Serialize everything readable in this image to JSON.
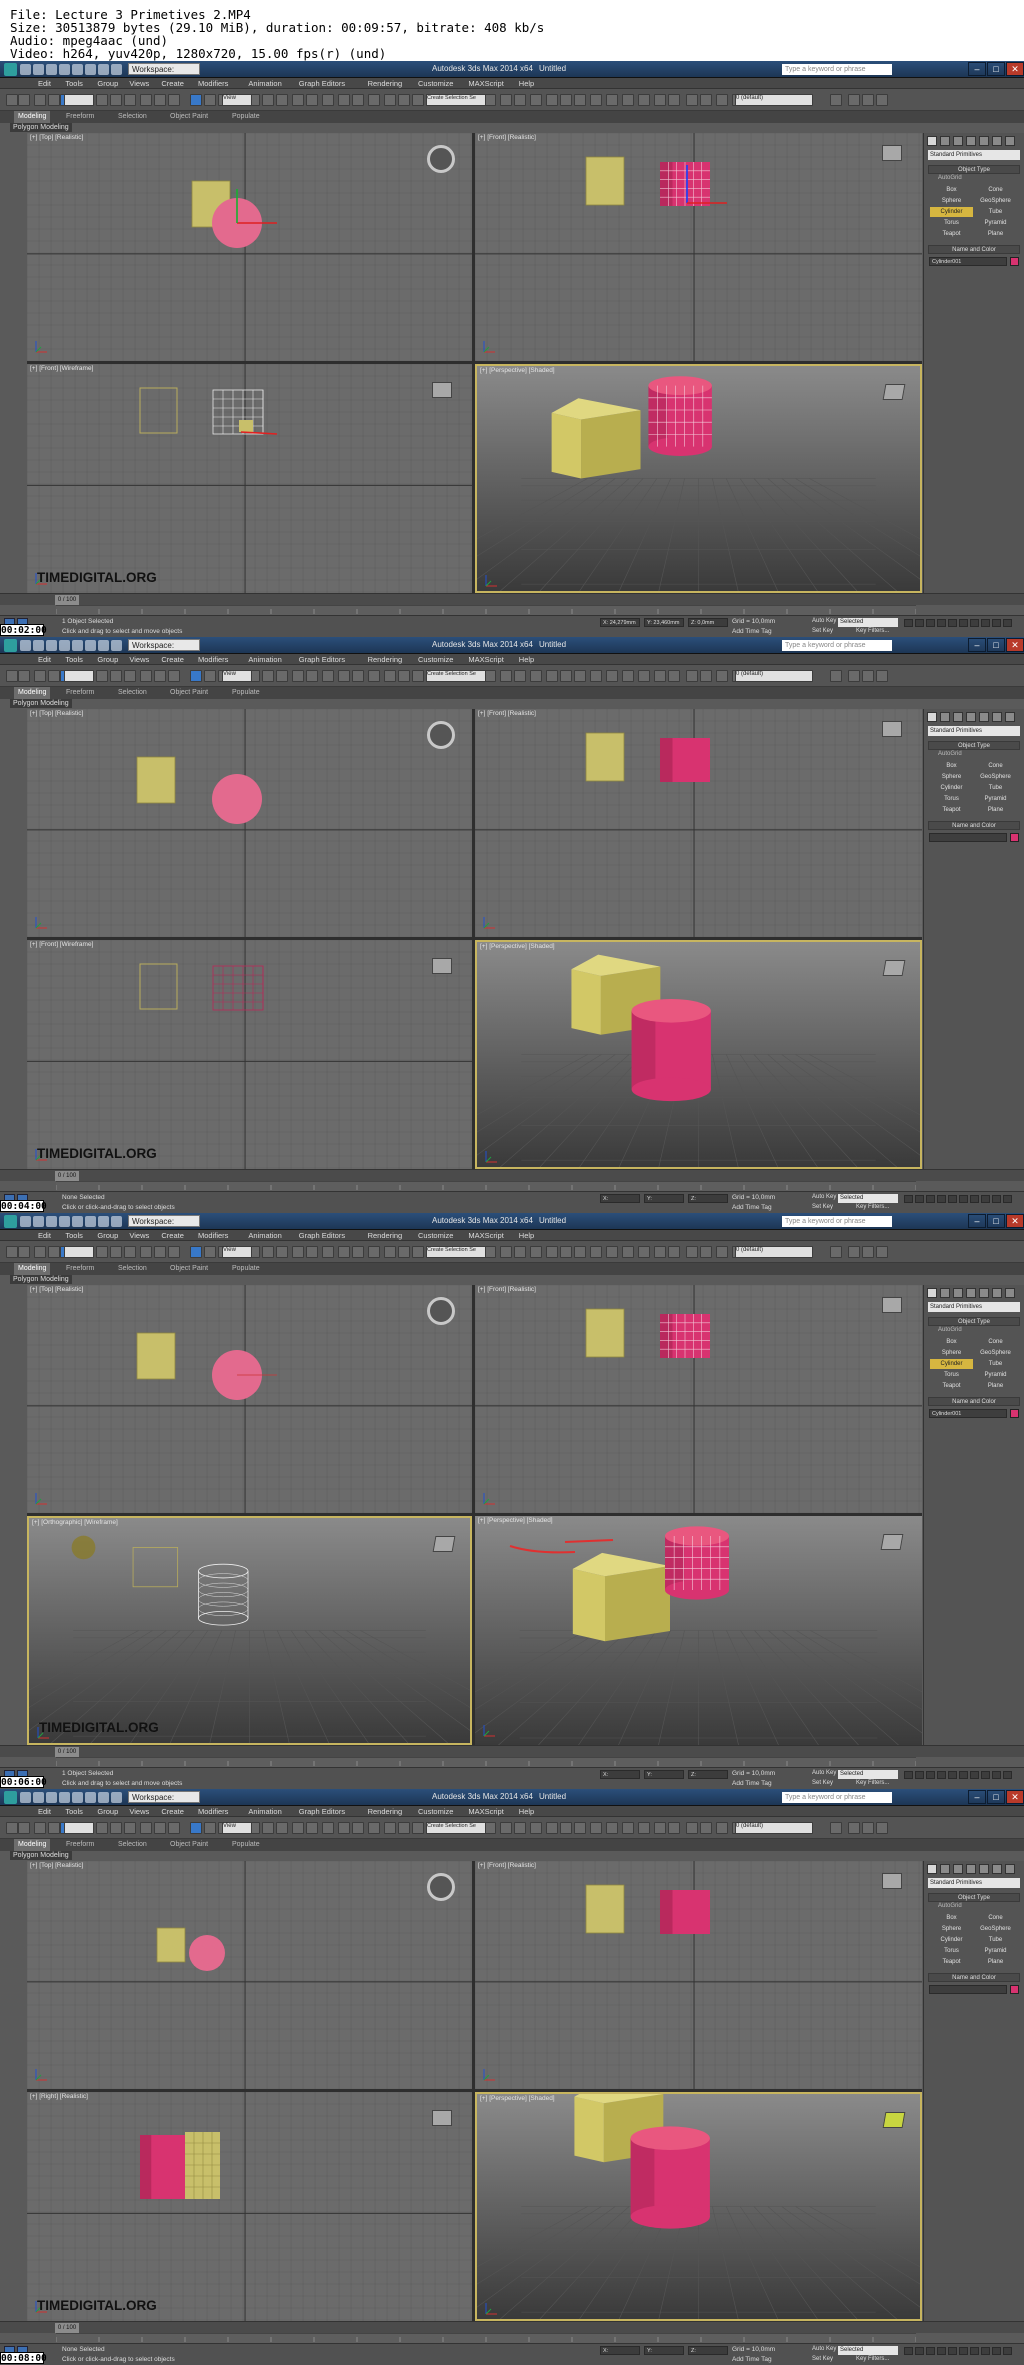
{
  "file_info": {
    "line1": "File: Lecture 3 Primetives 2.MP4",
    "line2": "Size: 30513879 bytes (29.10 MiB), duration: 00:09:57, bitrate: 408 kb/s",
    "line3": "Audio: mpeg4aac (und)",
    "line4": "Video: h264, yuv420p, 1280x720, 15.00 fps(r) (und)"
  },
  "app": {
    "title": "Autodesk 3ds Max 2014 x64",
    "doc": "Untitled",
    "workspace": "Workspace: Default",
    "search_placeholder": "Type a keyword or phrase",
    "menus": [
      "Edit",
      "Tools",
      "Group",
      "Views",
      "Create",
      "Modifiers",
      "Animation",
      "Graph Editors",
      "Rendering",
      "Customize",
      "MAXScript",
      "Help"
    ],
    "ribbon_tabs": [
      "Modeling",
      "Freeform",
      "Selection",
      "Object Paint",
      "Populate"
    ],
    "poly_tab": "Polygon Modeling",
    "layer": "0 (default)",
    "view_dropdown": "View",
    "selection_set": "Create Selection Se"
  },
  "command_panel": {
    "dropdown": "Standard Primitives",
    "object_type_header": "Object Type",
    "autogrid": "AutoGrid",
    "buttons": [
      "Box",
      "Cone",
      "Sphere",
      "GeoSphere",
      "Cylinder",
      "Tube",
      "Torus",
      "Pyramid",
      "Teapot",
      "Plane"
    ],
    "name_color_header": "Name and Color"
  },
  "timeline": {
    "frame": "0 / 100"
  },
  "status": {
    "hint": "Click and drag to select and move objects",
    "hint_select": "Click or click-and-drag to select objects",
    "grid": "Grid = 10,0mm",
    "add_time_tag": "Add Time Tag",
    "auto_key": "Auto Key",
    "set_key": "Set Key",
    "selected": "Selected",
    "key_filters": "Key Filters..."
  },
  "frames": [
    {
      "timestamp": "00:02:00",
      "viewports": [
        "[+] [Top] [Realistic]",
        "[+] [Front] [Realistic]",
        "[+] [Front] [Wireframe]",
        "[+] [Perspective] [Shaded]"
      ],
      "status_text": "1 Object Selected",
      "name_field": "Cylinder001",
      "coords": [
        "X: 24,279mm",
        "Y: 23,460mm",
        "Z: 0,0mm"
      ]
    },
    {
      "timestamp": "00:04:00",
      "viewports": [
        "[+] [Top] [Realistic]",
        "[+] [Front] [Realistic]",
        "[+] [Front] [Wireframe]",
        "[+] [Perspective] [Shaded]"
      ],
      "status_text": "None Selected",
      "name_field": "",
      "coords": [
        "X:",
        "Y:",
        "Z:"
      ]
    },
    {
      "timestamp": "00:06:00",
      "viewports": [
        "[+] [Top] [Realistic]",
        "[+] [Front] [Realistic]",
        "[+] [Orthographic] [Wireframe]",
        "[+] [Perspective] [Shaded]"
      ],
      "status_text": "1 Object Selected",
      "name_field": "Cylinder001",
      "coords": [
        "X:",
        "Y:",
        "Z:"
      ]
    },
    {
      "timestamp": "00:08:00",
      "viewports": [
        "[+] [Top] [Realistic]",
        "[+] [Front] [Realistic]",
        "[+] [Right] [Realistic]",
        "[+] [Perspective] [Shaded]"
      ],
      "status_text": "None Selected",
      "name_field": "",
      "coords": [
        "X:",
        "Y:",
        "Z:"
      ]
    }
  ],
  "watermark": "TIMEDIGITAL.ORG",
  "colors": {
    "cube": "#c8bf6a",
    "cylinder": "#d83370",
    "viewport": "#6b6b6b",
    "active_border": "#c7b55f"
  }
}
